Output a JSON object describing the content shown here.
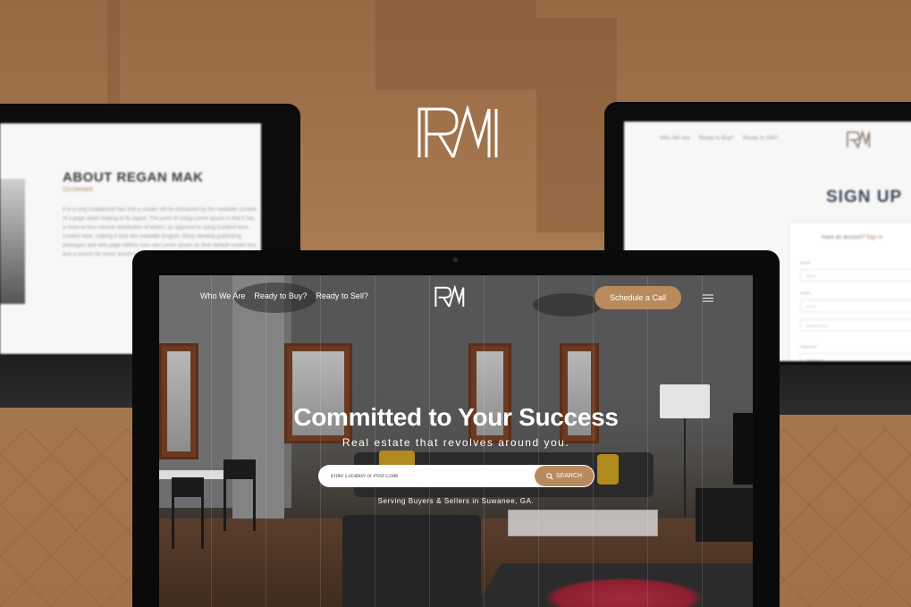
{
  "brand": {
    "accent": "#b98a5e",
    "background": "#a87c55"
  },
  "left_laptop": {
    "title": "ABOUT REGAN MAK",
    "subtitle": "CO-OWNER",
    "body": "It is a long established fact that a reader will be distracted by the readable content of a page when looking at its layout. The point of using Lorem Ipsum is that it has a more-or-less normal distribution of letters, as opposed to using Content here, content here, making it look like readable English. Many desktop publishing packages and web page editors now use Lorem Ipsum as their default model text, and a search for lorem ipsum will uncover many web sites still in their infancy."
  },
  "right_laptop": {
    "nav": [
      "Who We Are",
      "Ready to Buy?",
      "Ready to Sell?"
    ],
    "title": "SIGN UP",
    "have_account": "Have an account?",
    "sign_in": "Sign in",
    "fields": [
      {
        "label": "Name*",
        "placeholder": "Name"
      },
      {
        "label": "Email*",
        "placeholder": "Email"
      },
      {
        "label": "",
        "placeholder": "Mobile Phone"
      },
      {
        "label": "Password*",
        "placeholder": "Password"
      }
    ]
  },
  "main": {
    "nav": [
      "Who We Are",
      "Ready to Buy?",
      "Ready to Sell?"
    ],
    "cta": "Schedule a Call",
    "hero_title": "Committed to Your Success",
    "hero_subtitle": "Real estate that revolves around you.",
    "search": {
      "placeholder": "Enter Location or Post Code",
      "button": "SEARCH"
    },
    "serving": "Serving Buyers & Sellers in Suwanee, GA."
  },
  "icons": {
    "search": "search-icon",
    "menu": "hamburger-menu-icon",
    "logo": "rm-logo-icon"
  }
}
